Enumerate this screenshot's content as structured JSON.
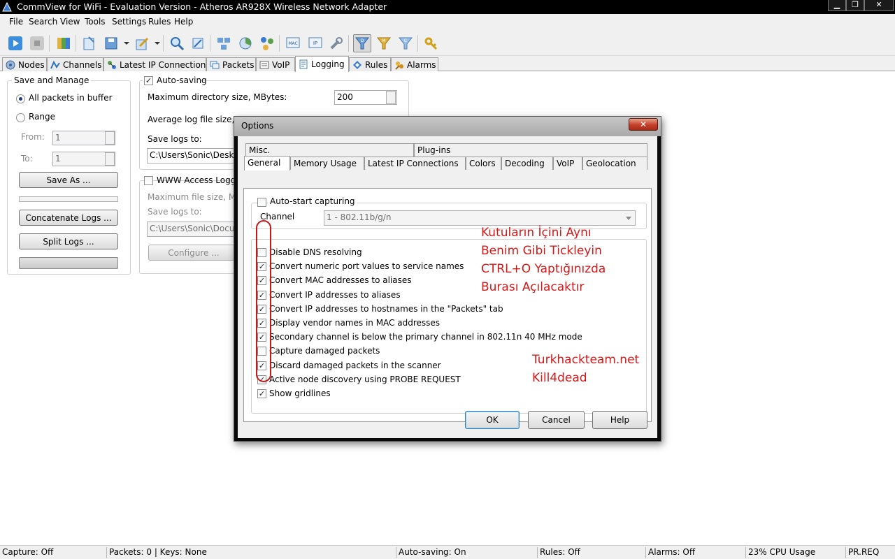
{
  "window": {
    "title": "CommView for WiFi - Evaluation Version - Atheros AR928X Wireless Network Adapter",
    "minimize": "▁",
    "maximize": "❐",
    "close": "✕"
  },
  "menu": [
    "File",
    "Search",
    "View",
    "Tools",
    "Settings",
    "Rules",
    "Help"
  ],
  "main_tabs": [
    {
      "label": "Nodes",
      "icon": "nodes-icon"
    },
    {
      "label": "Channels",
      "icon": "channels-icon"
    },
    {
      "label": "Latest IP Connections",
      "icon": "ip-connections-icon"
    },
    {
      "label": "Packets",
      "icon": "packets-icon"
    },
    {
      "label": "VoIP",
      "icon": "voip-icon"
    },
    {
      "label": "Logging",
      "icon": "logging-icon",
      "active": true
    },
    {
      "label": "Rules",
      "icon": "rules-icon"
    },
    {
      "label": "Alarms",
      "icon": "alarms-icon"
    }
  ],
  "save_manage": {
    "title": "Save and Manage",
    "all_packets": "All packets in buffer",
    "range": "Range",
    "from_label": "From:",
    "from_value": "1",
    "to_label": "To:",
    "to_value": "1",
    "save_as": "Save As ...",
    "concatenate": "Concatenate Logs ...",
    "split": "Split Logs ..."
  },
  "auto_saving": {
    "title": "Auto-saving",
    "max_dir_label": "Maximum directory size, MBytes:",
    "max_dir_value": "200",
    "avg_log_label": "Average log file size, MB",
    "save_logs_label": "Save logs to:",
    "save_logs_value": "C:\\Users\\Sonic\\Desktop"
  },
  "www_logging": {
    "title": "WWW Access Logging",
    "max_file_label": "Maximum file size, MB",
    "save_logs_label": "Save logs to:",
    "save_logs_value": "C:\\Users\\Sonic\\Documents",
    "configure": "Configure ..."
  },
  "dialog": {
    "title": "Options",
    "close": "✕",
    "tabs_row1": [
      "Misc.",
      "Plug-ins"
    ],
    "tabs_row2": [
      "General",
      "Memory Usage",
      "Latest IP Connections",
      "Colors",
      "Decoding",
      "VoIP",
      "Geolocation"
    ],
    "auto_start": "Auto-start capturing",
    "channel_label": "Channel",
    "channel_value": "1 - 802.11b/g/n",
    "options": [
      {
        "label": "Disable DNS resolving",
        "checked": false
      },
      {
        "label": "Convert numeric port values to service names",
        "checked": true
      },
      {
        "label": "Convert MAC addresses to aliases",
        "checked": true
      },
      {
        "label": "Convert IP addresses to aliases",
        "checked": true
      },
      {
        "label": "Convert IP addresses to hostnames in the \"Packets\" tab",
        "checked": true
      },
      {
        "label": "Display vendor names in MAC addresses",
        "checked": true
      },
      {
        "label": "Secondary channel is below the primary channel in 802.11n 40 MHz mode",
        "checked": true
      },
      {
        "label": "Capture damaged packets",
        "checked": false
      },
      {
        "label": "Discard damaged packets in the scanner",
        "checked": true
      },
      {
        "label": "Active node discovery using PROBE REQUEST",
        "checked": true
      },
      {
        "label": "Show gridlines",
        "checked": true
      }
    ],
    "ok": "OK",
    "cancel": "Cancel",
    "help": "Help"
  },
  "annotations": {
    "lines": [
      "Kutuların İçini Aynı",
      "Benim Gibi Tickleyin",
      "CTRL+O Yaptığınızda",
      "Burası Açılacaktır"
    ],
    "site": "Turkhackteam.net",
    "author": "Kill4dead",
    "color": "#d81818"
  },
  "status": {
    "capture": "Capture: Off",
    "packets": "Packets: 0 | Keys: None",
    "auto_saving": "Auto-saving: On",
    "rules": "Rules: Off",
    "alarms": "Alarms: Off",
    "cpu": "23% CPU Usage",
    "mode": "PR.REQ"
  },
  "check_mark": "✓"
}
